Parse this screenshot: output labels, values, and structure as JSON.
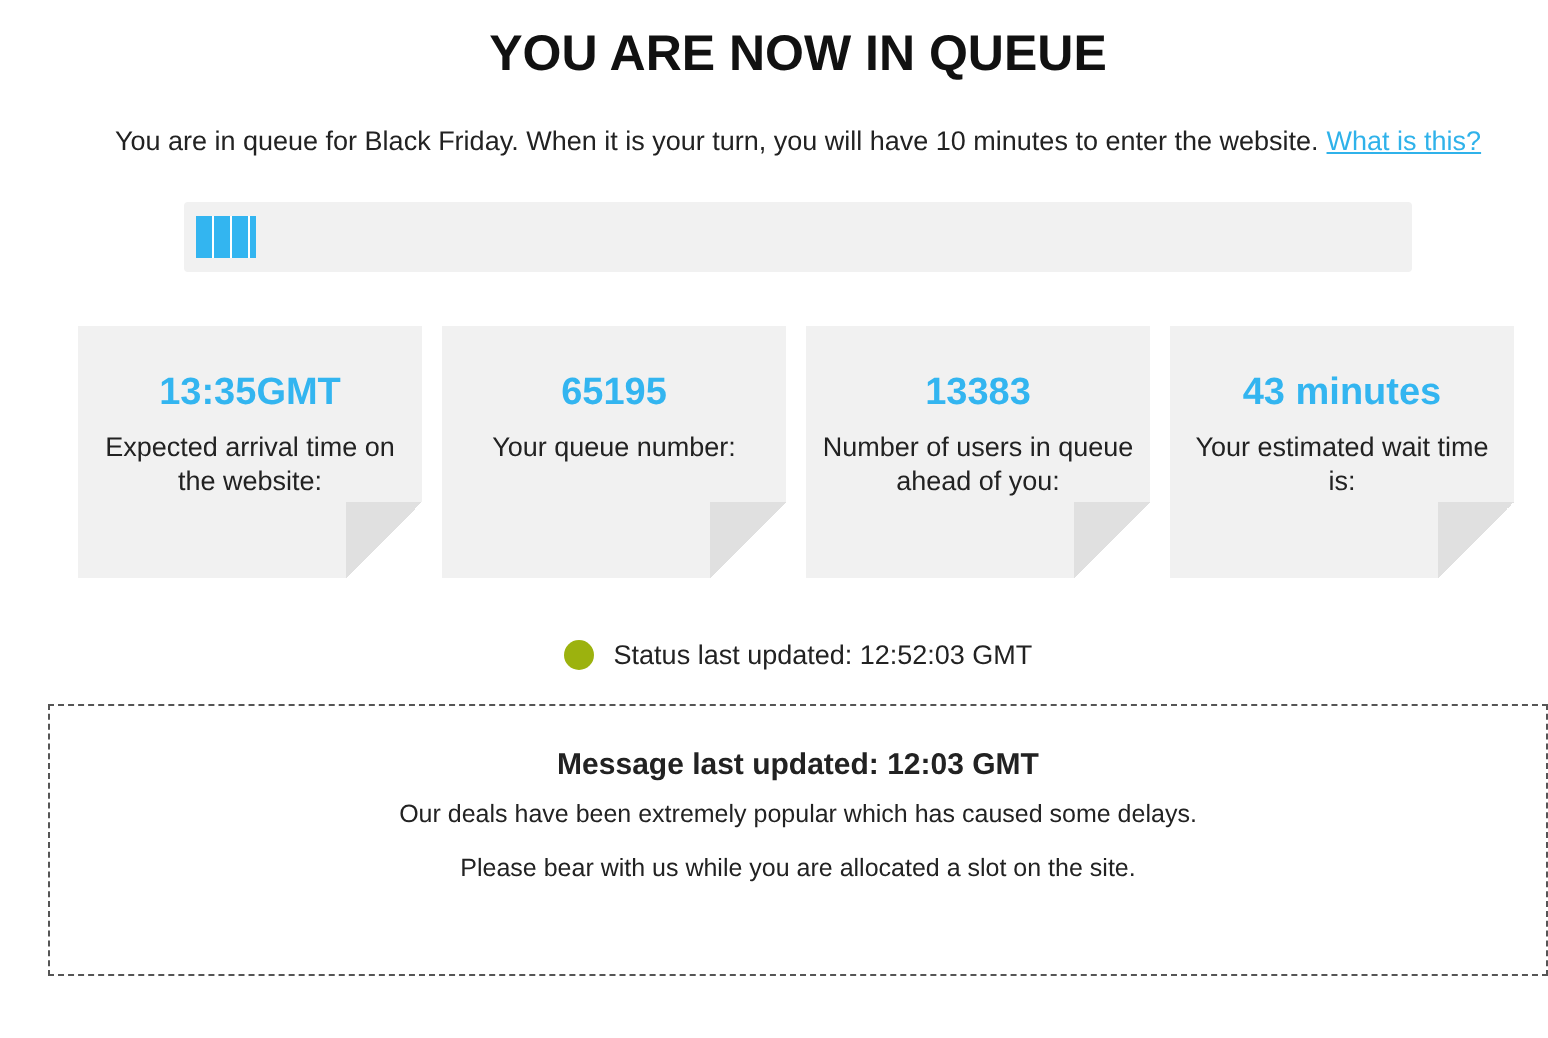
{
  "title": "YOU ARE NOW IN QUEUE",
  "intro": {
    "text": "You are in queue for Black Friday. When it is your turn, you will have 10 minutes to enter the website.",
    "link": "What is this?"
  },
  "progress": {
    "level": 0.05
  },
  "cards": [
    {
      "value": "13:35GMT",
      "label": "Expected arrival time on the website:"
    },
    {
      "value": "65195",
      "label": "Your queue number:"
    },
    {
      "value": "13383",
      "label": "Number of users in queue ahead of you:"
    },
    {
      "value": "43 minutes",
      "label": "Your estimated wait time is:"
    }
  ],
  "status": {
    "color": "#9cb20e",
    "text": "Status last updated: 12:52:03 GMT"
  },
  "message": {
    "title": "Message last updated: 12:03 GMT",
    "lines": [
      "Our deals have been extremely popular which has caused some delays.",
      "Please bear with us while you are allocated a slot on the site."
    ]
  }
}
